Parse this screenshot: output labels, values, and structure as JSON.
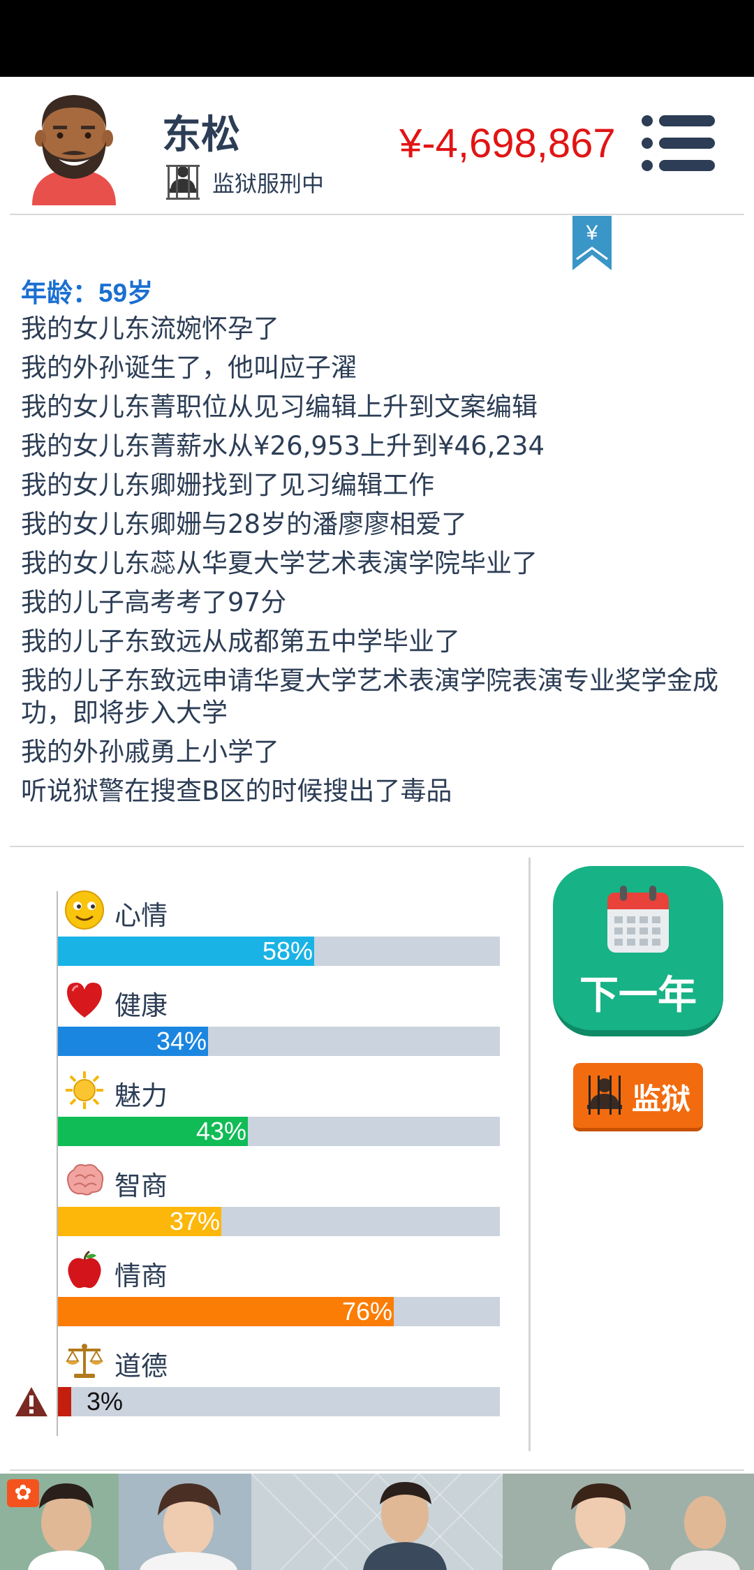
{
  "player": {
    "name": "东松",
    "status": "监狱服刑中",
    "money": "¥-4,698,867",
    "avatar": "bearded-man-avatar"
  },
  "header": {
    "menu_icon": "list-menu-icon",
    "bookmark_icon": "yen-bookmark-icon",
    "bookmark_glyph": "¥"
  },
  "log": {
    "age_label": "年龄：",
    "age_value": "59岁",
    "events": [
      "我的女儿东流婉怀孕了",
      "我的外孙诞生了，他叫应子濯",
      "我的女儿东菁职位从见习编辑上升到文案编辑",
      "我的女儿东菁薪水从¥26,953上升到¥46,234",
      "我的女儿东卿姗找到了见习编辑工作",
      "我的女儿东卿姗与28岁的潘廖廖相爱了",
      "我的女儿东蕊从华夏大学艺术表演学院毕业了",
      "我的儿子高考考了97分",
      "我的儿子东致远从成都第五中学毕业了",
      "我的儿子东致远申请华夏大学艺术表演学院表演专业奖学金成功，即将步入大学",
      "我的外孙戚勇上小学了",
      "听说狱警在搜查B区的时候搜出了毒品"
    ]
  },
  "stats": [
    {
      "label": "心情",
      "percent": "58%",
      "fill": 0.58,
      "color": "#1ab3e6",
      "icon": "smiley-icon"
    },
    {
      "label": "健康",
      "percent": "34%",
      "fill": 0.34,
      "color": "#1a86e0",
      "icon": "heart-icon"
    },
    {
      "label": "魅力",
      "percent": "43%",
      "fill": 0.43,
      "color": "#10bc55",
      "icon": "sun-icon"
    },
    {
      "label": "智商",
      "percent": "37%",
      "fill": 0.37,
      "color": "#fdb70b",
      "icon": "brain-icon"
    },
    {
      "label": "情商",
      "percent": "76%",
      "fill": 0.76,
      "color": "#fc7d05",
      "icon": "apple-icon"
    },
    {
      "label": "道德",
      "percent": "3%",
      "fill": 0.03,
      "color": "#c41e0f",
      "icon": "scales-icon",
      "warning": true
    }
  ],
  "actions": {
    "next_year": "下一年",
    "prison": "监狱"
  },
  "colors": {
    "money": "#e11414",
    "age": "#1a6fd1",
    "next_year_button": "#17b285",
    "prison_button": "#f26b0f",
    "bar_track": "#cbd3de"
  },
  "ad": {
    "badge_icon": "ad-logo-icon"
  }
}
